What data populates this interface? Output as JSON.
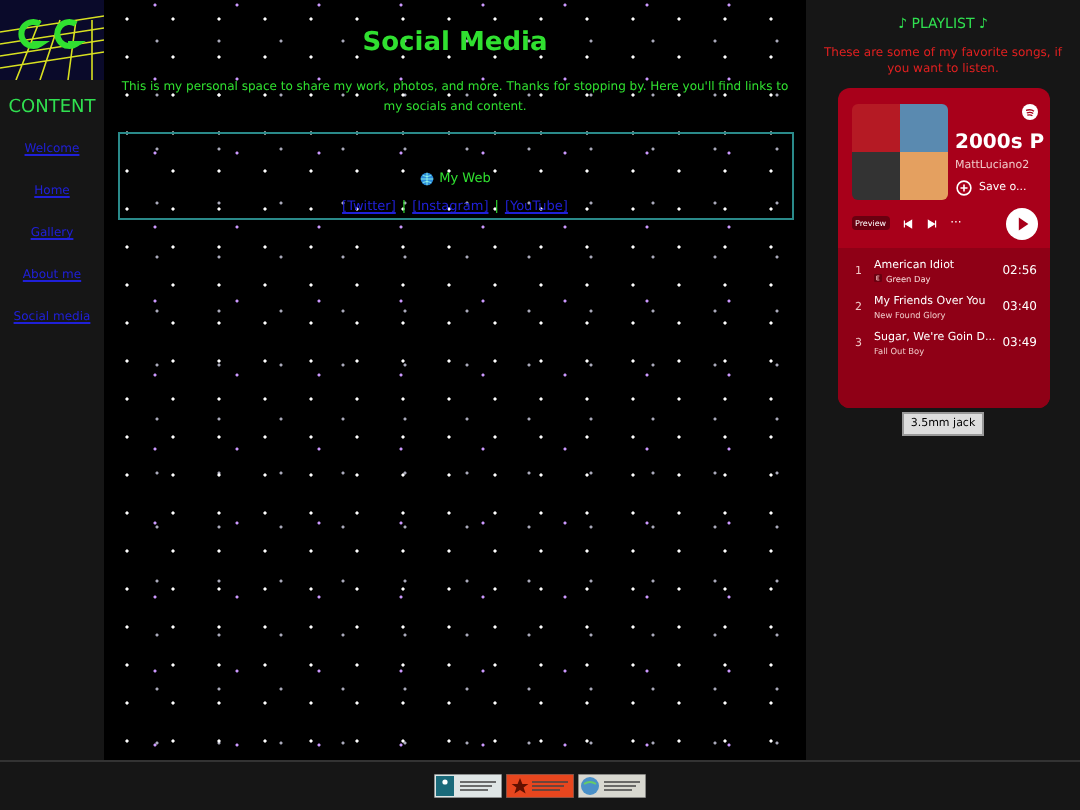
{
  "sidebar": {
    "heading": "CONTENT",
    "links": [
      "Welcome",
      "Home",
      "Gallery",
      "About me",
      "Social media"
    ]
  },
  "main": {
    "title": "Social Media",
    "intro": "This is my personal space to share my work, photos, and more. Thanks for stopping by. Here you'll find links to my socials and content.",
    "box": {
      "web_link": "My Web",
      "links": [
        "[Twitter]",
        "[Instagram]",
        "[YouTube]"
      ],
      "separator": "|"
    }
  },
  "playlist": {
    "heading": "♪ PLAYLIST ♪",
    "description": "These are some of my favorite songs, if you want to listen.",
    "embed": {
      "title": "2000s P",
      "owner": "MattLuciano2",
      "save_label": "Save o...",
      "preview_label": "Preview",
      "more_label": "···",
      "tracks": [
        {
          "number": "1",
          "title": "American Idiot",
          "artist": "Green Day",
          "duration": "02:56",
          "explicit": true
        },
        {
          "number": "2",
          "title": "My Friends Over You",
          "artist": "New Found Glory",
          "duration": "03:40",
          "explicit": false
        },
        {
          "number": "3",
          "title": "Sugar, We're Goin D...",
          "artist": "Fall Out Boy",
          "duration": "03:49",
          "explicit": false
        }
      ]
    },
    "jack_button": "3.5mm jack"
  },
  "footer": {
    "badges": [
      {
        "kind": "wheelchair"
      },
      {
        "kind": "star"
      },
      {
        "kind": "globe"
      }
    ]
  }
}
